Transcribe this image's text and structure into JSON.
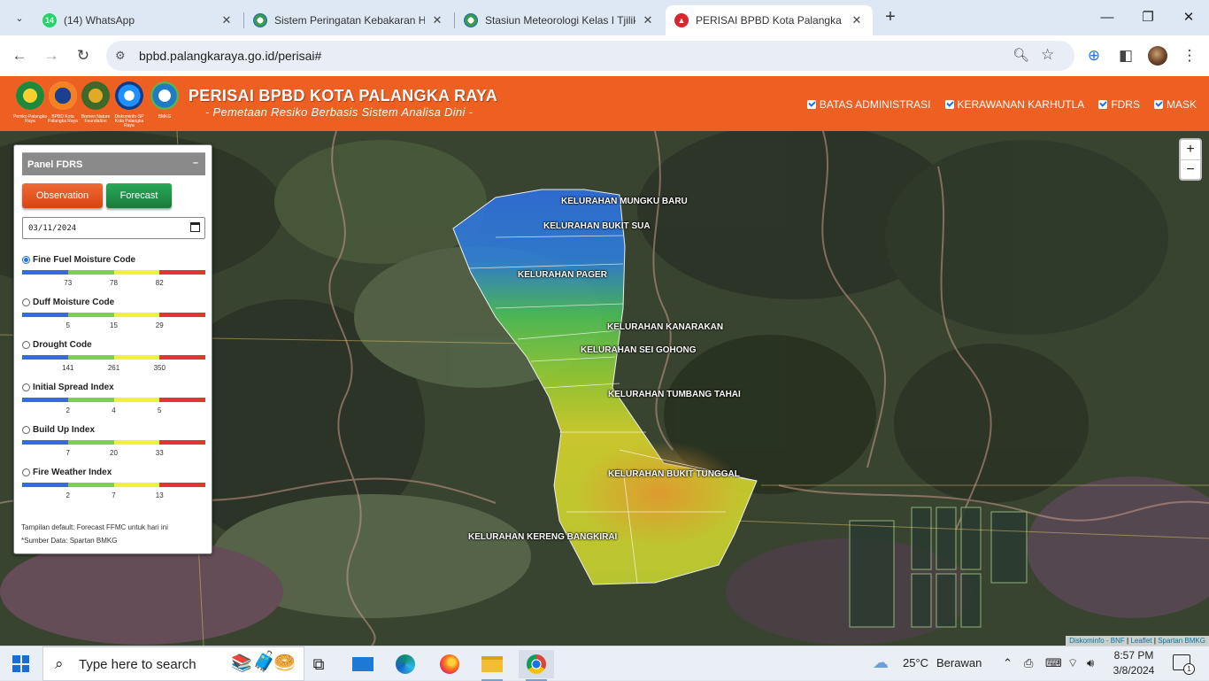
{
  "browser": {
    "tabs": [
      {
        "title": "(14) WhatsApp",
        "badge": "14"
      },
      {
        "title": "Sistem Peringatan Kebakaran H"
      },
      {
        "title": "Stasiun Meteorologi Kelas I Tjilik"
      },
      {
        "title": "PERISAI BPBD Kota Palangka Ra"
      }
    ],
    "url": "bpbd.palangkaraya.go.id/perisai#"
  },
  "header": {
    "title": "PERISAI BPBD KOTA PALANGKA RAYA",
    "subtitle": "- Pemetaan Resiko Berbasis Sistem Analisa Dini -",
    "logo_captions": [
      "Pemko Palangka Raya",
      "BPBD Kota Palangka Raya",
      "Borneo Nature Foundation",
      "Diskominfo-SP Kota Palangka Raya",
      "BMKG"
    ],
    "layers": [
      "BATAS ADMINISTRASI",
      "KERAWANAN KARHUTLA",
      "FDRS",
      "MASK"
    ]
  },
  "map": {
    "zoom_in": "+",
    "zoom_out": "−",
    "attribution_links": [
      "Diskominfo - BNF",
      "Leaflet",
      "Spartan BMKG"
    ],
    "attribution_sep": " | ",
    "kelurahan": [
      "KELURAHAN MUNGKU BARU",
      "KELURAHAN BUKIT SUA",
      "KELURAHAN PAGER",
      "KELURAHAN KANARAKAN",
      "KELURAHAN SEI GOHONG",
      "KELURAHAN TUMBANG TAHAI",
      "KELURAHAN BUKIT TUNGGAL",
      "KELURAHAN KERENG BANGKIRAI"
    ]
  },
  "panel": {
    "title": "Panel FDRS",
    "minimize": "–",
    "observation_label": "Observation",
    "forecast_label": "Forecast",
    "date_value": "03/11/2024",
    "indices": [
      {
        "label": "Fine Fuel Moisture Code",
        "ticks": [
          "73",
          "78",
          "82"
        ],
        "selected": true
      },
      {
        "label": "Duff Moisture Code",
        "ticks": [
          "5",
          "15",
          "29"
        ]
      },
      {
        "label": "Drought Code",
        "ticks": [
          "141",
          "261",
          "350"
        ]
      },
      {
        "label": "Initial Spread Index",
        "ticks": [
          "2",
          "4",
          "5"
        ]
      },
      {
        "label": "Build Up Index",
        "ticks": [
          "7",
          "20",
          "33"
        ]
      },
      {
        "label": "Fire Weather Index",
        "ticks": [
          "2",
          "7",
          "13"
        ]
      }
    ],
    "bar_colors": [
      "#2f6fe0",
      "#7ed24b",
      "#f2ee3c",
      "#e2352b"
    ],
    "note1": "Tampilan default: Forecast FFMC untuk hari ini",
    "note2": "*Sumber Data: Spartan BMKG"
  },
  "taskbar": {
    "search_placeholder": "Type here to search",
    "weather_temp": "25°C",
    "weather_text": "Berawan",
    "time": "8:57 PM",
    "date": "3/8/2024",
    "notifications": "1"
  }
}
